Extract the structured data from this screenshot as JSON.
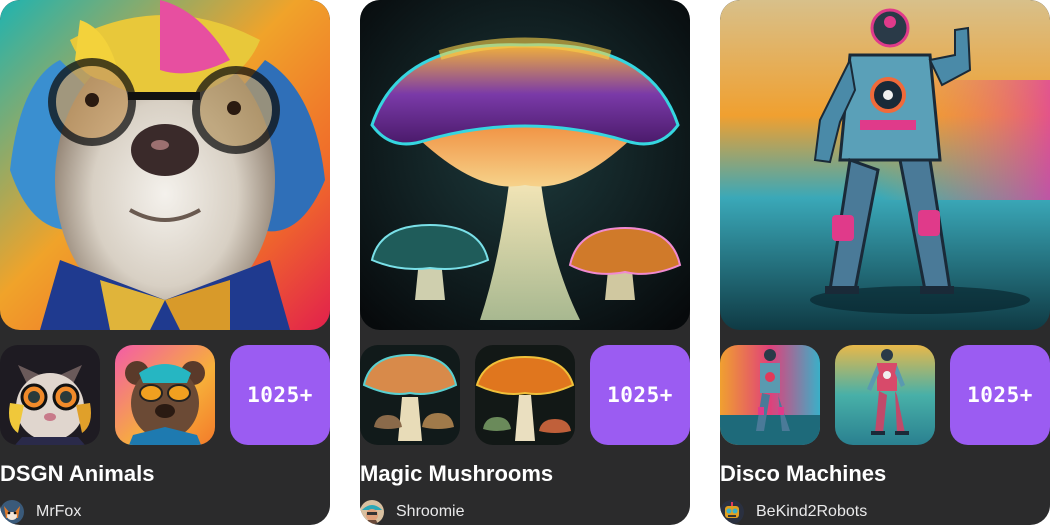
{
  "accent": "#9b5cf2",
  "collections": [
    {
      "title": "DSGN Animals",
      "count": "1025+",
      "author": "MrFox",
      "hero_image": "colorful-dog-with-glasses",
      "thumbnails": [
        "cat-with-goggles",
        "bear-with-sunglasses"
      ],
      "avatar_image": "fox-avatar"
    },
    {
      "title": "Magic Mushrooms",
      "count": "1025+",
      "author": "Shroomie",
      "hero_image": "glowing-mushroom",
      "thumbnails": [
        "mushroom-cluster",
        "mushroom-cluster-orange"
      ],
      "avatar_image": "shroomie-avatar"
    },
    {
      "title": "Disco Machines",
      "count": "1025+",
      "author": "BeKind2Robots",
      "hero_image": "neon-robot-astronaut",
      "thumbnails": [
        "robot-walking",
        "robot-standing"
      ],
      "avatar_image": "robot-avatar"
    }
  ]
}
